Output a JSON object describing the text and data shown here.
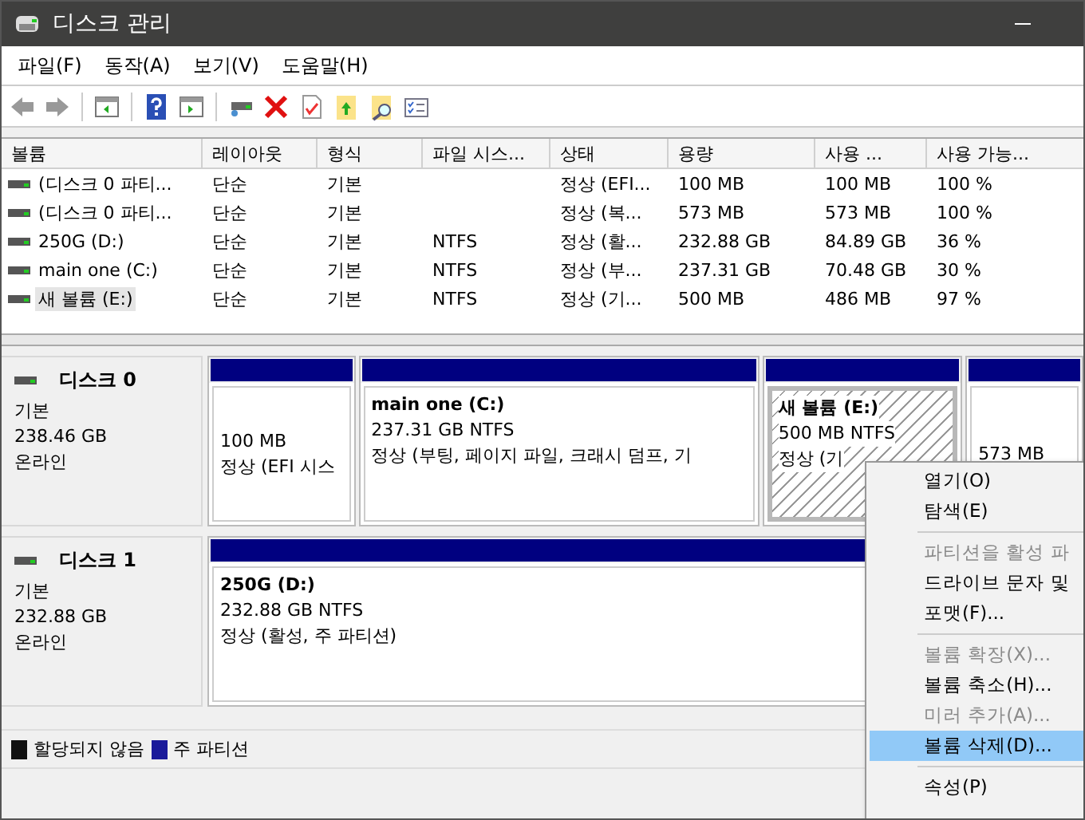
{
  "window": {
    "title": "디스크 관리"
  },
  "menu": [
    "파일(F)",
    "동작(A)",
    "보기(V)",
    "도움말(H)"
  ],
  "volume_table": {
    "columns": [
      "볼륨",
      "레이아웃",
      "형식",
      "파일 시스...",
      "상태",
      "용량",
      "사용 ...",
      "사용 가능..."
    ],
    "rows": [
      {
        "cells": [
          "(디스크 0 파티...",
          "단순",
          "기본",
          "",
          "정상 (EFI...",
          "100 MB",
          "100 MB",
          "100 %"
        ],
        "selected": false
      },
      {
        "cells": [
          "(디스크 0 파티...",
          "단순",
          "기본",
          "",
          "정상 (복...",
          "573 MB",
          "573 MB",
          "100 %"
        ],
        "selected": false
      },
      {
        "cells": [
          "250G (D:)",
          "단순",
          "기본",
          "NTFS",
          "정상 (활...",
          "232.88 GB",
          "84.89 GB",
          "36 %"
        ],
        "selected": false
      },
      {
        "cells": [
          "main one (C:)",
          "단순",
          "기본",
          "NTFS",
          "정상 (부...",
          "237.31 GB",
          "70.48 GB",
          "30 %"
        ],
        "selected": false
      },
      {
        "cells": [
          "새 볼륨 (E:)",
          "단순",
          "기본",
          "NTFS",
          "정상 (기...",
          "500 MB",
          "486 MB",
          "97 %"
        ],
        "selected": true
      }
    ]
  },
  "disks": [
    {
      "name": "디스크 0",
      "type": "기본",
      "size": "238.46 GB",
      "status": "온라인",
      "partitions": [
        {
          "lines": [
            "100 MB",
            "정상 (EFI 시스"
          ],
          "selected": false
        },
        {
          "title": "main one  (C:)",
          "lines": [
            "237.31 GB NTFS",
            "정상 (부팅, 페이지 파일, 크래시 덤프, 기"
          ],
          "selected": false
        },
        {
          "title": "새 볼륨  (E:)",
          "lines": [
            "500 MB NTFS",
            "정상 (기"
          ],
          "selected": true
        },
        {
          "lines": [
            "573 MB"
          ],
          "selected": false
        }
      ]
    },
    {
      "name": "디스크 1",
      "type": "기본",
      "size": "232.88 GB",
      "status": "온라인",
      "partitions": [
        {
          "title": "250G  (D:)",
          "lines": [
            "232.88 GB NTFS",
            "정상 (활성, 주 파티션)"
          ],
          "selected": false
        }
      ]
    }
  ],
  "legend": [
    {
      "label": "할당되지 않음",
      "color": "#111111"
    },
    {
      "label": "주 파티션",
      "color": "#1a1a9a"
    }
  ],
  "context_menu": [
    {
      "kind": "item",
      "label": "열기(O)",
      "disabled": false,
      "selected": false
    },
    {
      "kind": "item",
      "label": "탐색(E)",
      "disabled": false,
      "selected": false
    },
    {
      "kind": "separator"
    },
    {
      "kind": "item",
      "label": "파티션을 활성 파",
      "disabled": true,
      "selected": false
    },
    {
      "kind": "item",
      "label": "드라이브 문자 및",
      "disabled": false,
      "selected": false
    },
    {
      "kind": "item",
      "label": "포맷(F)...",
      "disabled": false,
      "selected": false
    },
    {
      "kind": "separator"
    },
    {
      "kind": "item",
      "label": "볼륨 확장(X)...",
      "disabled": true,
      "selected": false
    },
    {
      "kind": "item",
      "label": "볼륨 축소(H)...",
      "disabled": false,
      "selected": false
    },
    {
      "kind": "item",
      "label": "미러 추가(A)...",
      "disabled": true,
      "selected": false
    },
    {
      "kind": "item",
      "label": "볼륨 삭제(D)...",
      "disabled": false,
      "selected": true
    },
    {
      "kind": "separator"
    },
    {
      "kind": "item",
      "label": "속성(P)",
      "disabled": false,
      "selected": false
    }
  ]
}
